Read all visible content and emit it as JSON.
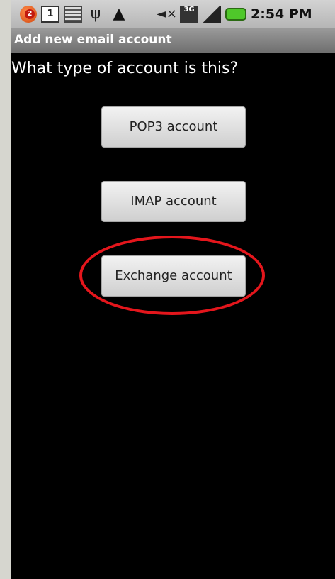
{
  "status_bar": {
    "notification_count": "2",
    "calendar_day": "1",
    "network_label": "3G",
    "time": "2:54 PM",
    "icons": [
      "notification-icon",
      "calendar-icon",
      "keyboard-icon",
      "usb-icon",
      "warning-icon",
      "mute-icon",
      "3g-icon",
      "signal-icon",
      "battery-icon"
    ]
  },
  "title_bar": {
    "title": "Add new email account"
  },
  "main": {
    "question": "What type of account is this?",
    "buttons": [
      {
        "label": "POP3 account"
      },
      {
        "label": "IMAP account"
      },
      {
        "label": "Exchange account"
      }
    ],
    "highlight_color": "#e4161c"
  }
}
